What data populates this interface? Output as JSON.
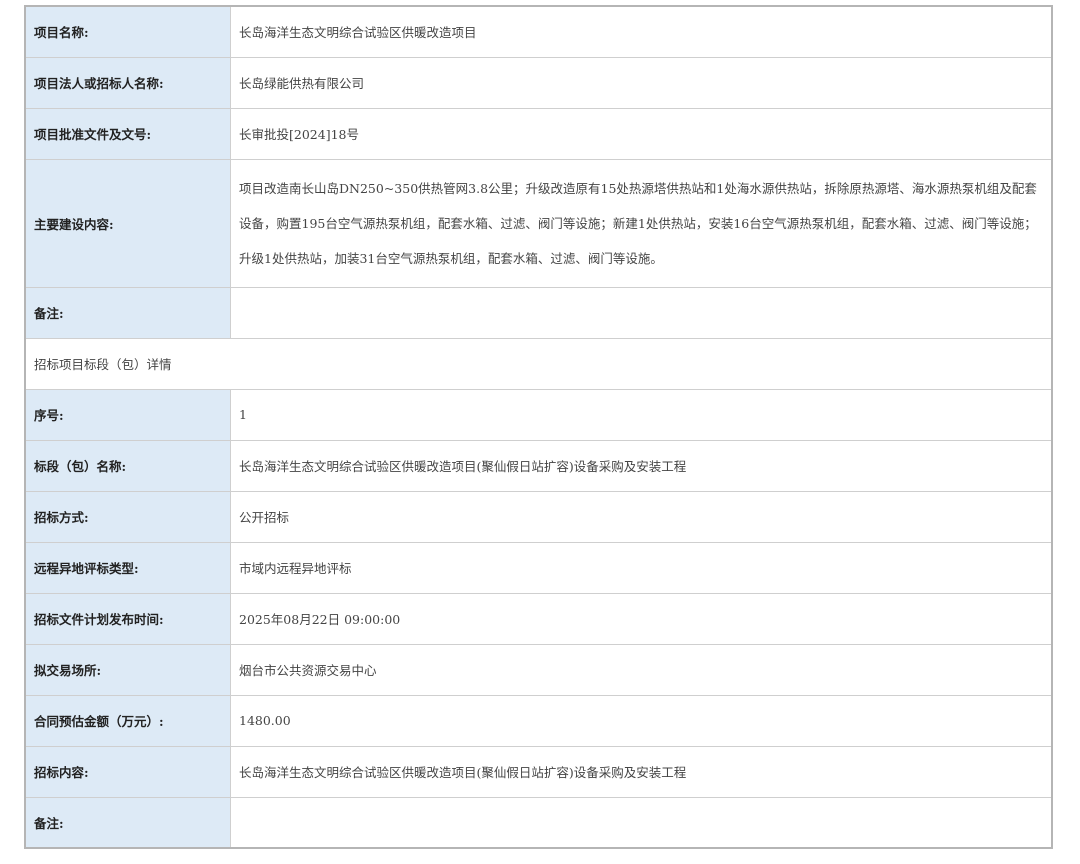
{
  "project": {
    "rows": [
      {
        "label": "项目名称:",
        "value": "长岛海洋生态文明综合试验区供暖改造项目"
      },
      {
        "label": "项目法人或招标人名称:",
        "value": "长岛绿能供热有限公司"
      },
      {
        "label": "项目批准文件及文号:",
        "value": "长审批投[2024]18号"
      },
      {
        "label": "主要建设内容:",
        "value": "项目改造南长山岛DN250~350供热管网3.8公里；升级改造原有15处热源塔供热站和1处海水源供热站，拆除原热源塔、海水源热泵机组及配套设备，购置195台空气源热泵机组，配套水箱、过滤、阀门等设施；新建1处供热站，安装16台空气源热泵机组，配套水箱、过滤、阀门等设施；升级1处供热站，加装31台空气源热泵机组，配套水箱、过滤、阀门等设施。"
      },
      {
        "label": "备注:",
        "value": ""
      }
    ]
  },
  "section_title": "招标项目标段（包）详情",
  "bid": {
    "rows": [
      {
        "label": "序号:",
        "value": "1"
      },
      {
        "label": "标段（包）名称:",
        "value": "长岛海洋生态文明综合试验区供暖改造项目(聚仙假日站扩容)设备采购及安装工程"
      },
      {
        "label": "招标方式:",
        "value": "公开招标"
      },
      {
        "label": "远程异地评标类型:",
        "value": "市域内远程异地评标"
      },
      {
        "label": "招标文件计划发布时间:",
        "value": "2025年08月22日 09:00:00"
      },
      {
        "label": "拟交易场所:",
        "value": "烟台市公共资源交易中心"
      },
      {
        "label": "合同预估金额（万元）:",
        "value": "1480.00"
      },
      {
        "label": "招标内容:",
        "value": "长岛海洋生态文明综合试验区供暖改造项目(聚仙假日站扩容)设备采购及安装工程"
      },
      {
        "label": "备注:",
        "value": ""
      }
    ]
  }
}
